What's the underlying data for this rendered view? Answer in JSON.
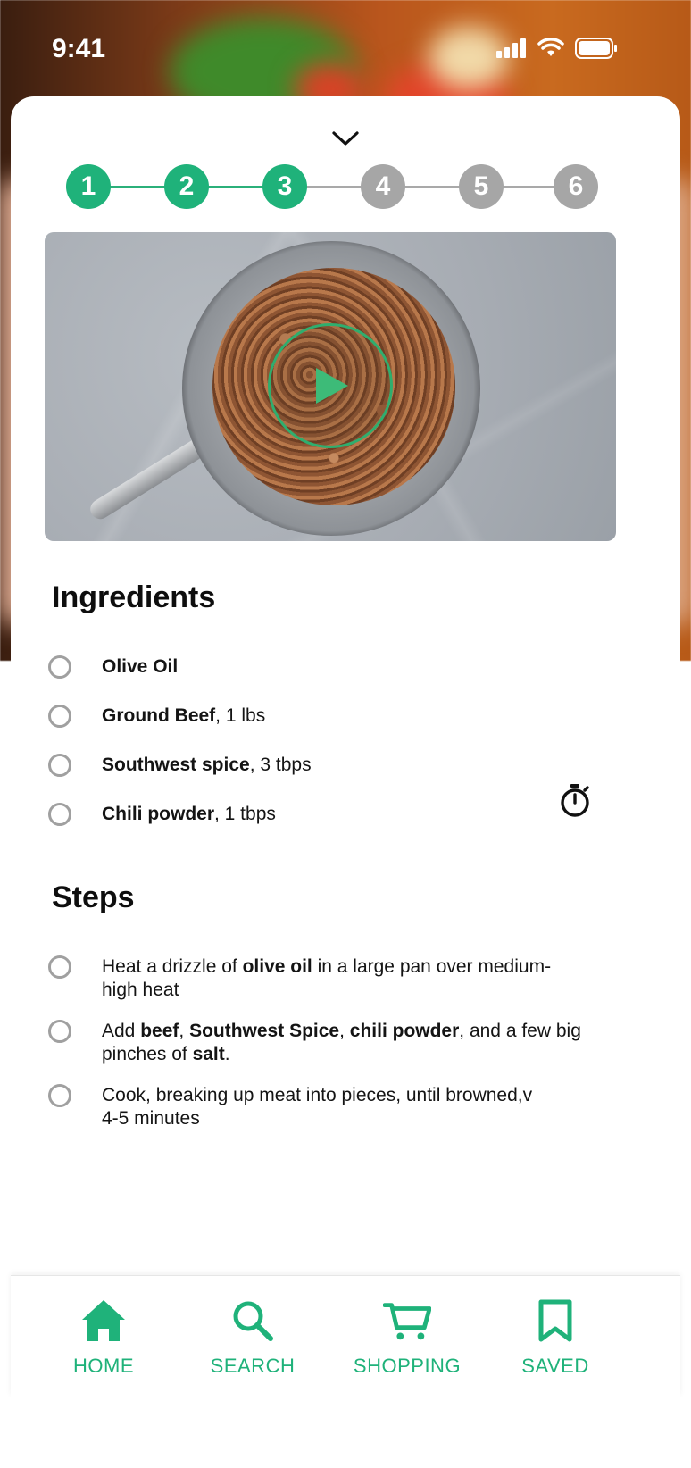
{
  "status_bar": {
    "time": "9:41"
  },
  "stepper": {
    "steps": [
      "1",
      "2",
      "3",
      "4",
      "5",
      "6"
    ],
    "completed_count": 3,
    "colors": {
      "done": "#1fb27a",
      "todo": "#a6a6a6"
    }
  },
  "video": {
    "play_icon": "play-icon"
  },
  "ingredients": {
    "title": "Ingredients",
    "items": [
      {
        "name": "Olive Oil",
        "qty": ""
      },
      {
        "name": "Ground Beef",
        "qty": ", 1 lbs"
      },
      {
        "name": "Southwest spice",
        "qty": ", 3 tbps"
      },
      {
        "name": "Chili powder",
        "qty": ", 1 tbps"
      }
    ]
  },
  "steps": {
    "title": "Steps",
    "timer_icon": "timer-icon",
    "items": [
      {
        "parts": [
          {
            "t": "Heat a drizzle of ",
            "b": false
          },
          {
            "t": "olive oil",
            "b": true
          },
          {
            "t": " in a large pan over medium-high heat",
            "b": false
          }
        ]
      },
      {
        "parts": [
          {
            "t": "Add ",
            "b": false
          },
          {
            "t": "beef",
            "b": true
          },
          {
            "t": ", ",
            "b": false
          },
          {
            "t": "Southwest Spice",
            "b": true
          },
          {
            "t": ", ",
            "b": false
          },
          {
            "t": "chili powder",
            "b": true
          },
          {
            "t": ", and a few big pinches of ",
            "b": false
          },
          {
            "t": "salt",
            "b": true
          },
          {
            "t": ".",
            "b": false
          }
        ]
      },
      {
        "parts": [
          {
            "t": "Cook, breaking up meat into pieces, until browned,v",
            "b": false
          },
          {
            "t": "4-5 minutes",
            "b": false,
            "newline": true
          }
        ]
      }
    ]
  },
  "bottom_nav": {
    "accent": "#1fb27a",
    "items": [
      {
        "label": "HOME",
        "icon": "home-icon"
      },
      {
        "label": "SEARCH",
        "icon": "search-icon"
      },
      {
        "label": "SHOPPING",
        "icon": "cart-icon"
      },
      {
        "label": "SAVED",
        "icon": "bookmark-icon"
      }
    ]
  }
}
